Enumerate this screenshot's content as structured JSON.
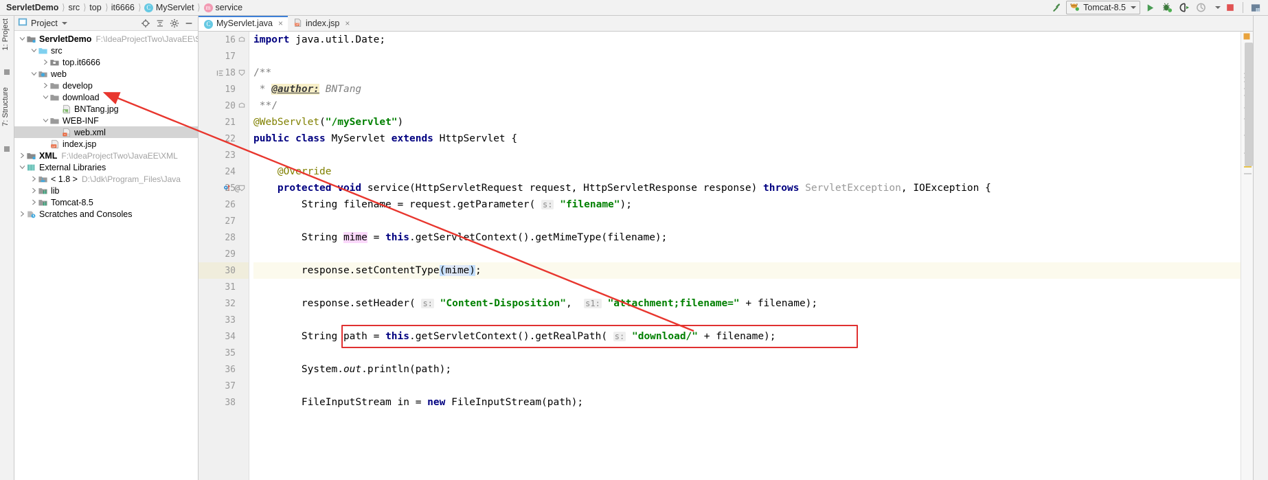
{
  "breadcrumb": {
    "items": [
      {
        "label": "ServletDemo",
        "icon": "",
        "bold": true
      },
      {
        "label": "src",
        "icon": "",
        "bold": false
      },
      {
        "label": "top",
        "icon": "",
        "bold": false
      },
      {
        "label": "it6666",
        "icon": "",
        "bold": false
      },
      {
        "label": "MyServlet",
        "icon": "class-icon",
        "bold": false
      },
      {
        "label": "service",
        "icon": "method-icon",
        "bold": false
      }
    ]
  },
  "toolbar": {
    "build_icon": "hammer-icon",
    "run_config": {
      "label": "Tomcat-8.5",
      "icon": "tomcat-icon",
      "dropdown": "chevron-down-icon"
    },
    "run_icon": "run-triangle-icon",
    "debug_icon": "debug-bug-icon",
    "run_coverage_icon": "run-with-coverage-icon",
    "profile_icon": "profiler-icon",
    "profile_dropdown": "chevron-down-icon",
    "stop_icon": "stop-square-icon",
    "layout_icon": "window-layout-icon",
    "accent_run": "#499c54",
    "accent_stop": "#e05252",
    "accent_tab": "#3d7fd6"
  },
  "left_strip": {
    "project_label": "1: Project",
    "structure_label": "7: Structure"
  },
  "project_panel": {
    "title": "Project",
    "title_icon": "project-view-icon",
    "actions": [
      {
        "name": "locate-icon"
      },
      {
        "name": "collapse-all-icon"
      },
      {
        "name": "settings-gear-icon"
      },
      {
        "name": "hide-minus-icon"
      }
    ],
    "tree": [
      {
        "indent": 0,
        "arrow": "down",
        "icon": "module-icon",
        "label": "ServletDemo",
        "bold": true,
        "path": "F:\\IdeaProjectTwo\\JavaEE\\ServletD",
        "selected": false
      },
      {
        "indent": 1,
        "arrow": "down",
        "icon": "source-folder-icon",
        "label": "src",
        "bold": false,
        "path": "",
        "selected": false
      },
      {
        "indent": 2,
        "arrow": "right",
        "icon": "package-icon",
        "label": "top.it6666",
        "bold": false,
        "path": "",
        "selected": false
      },
      {
        "indent": 1,
        "arrow": "down",
        "icon": "web-folder-icon",
        "label": "web",
        "bold": false,
        "path": "",
        "selected": false
      },
      {
        "indent": 2,
        "arrow": "right",
        "icon": "folder-icon",
        "label": "develop",
        "bold": false,
        "path": "",
        "selected": false
      },
      {
        "indent": 2,
        "arrow": "down",
        "icon": "folder-icon",
        "label": "download",
        "bold": false,
        "path": "",
        "selected": false
      },
      {
        "indent": 3,
        "arrow": "none",
        "icon": "image-file-icon",
        "label": "BNTang.jpg",
        "bold": false,
        "path": "",
        "selected": false
      },
      {
        "indent": 2,
        "arrow": "down",
        "icon": "folder-icon",
        "label": "WEB-INF",
        "bold": false,
        "path": "",
        "selected": false
      },
      {
        "indent": 3,
        "arrow": "none",
        "icon": "xml-file-icon",
        "label": "web.xml",
        "bold": false,
        "path": "",
        "selected": true
      },
      {
        "indent": 2,
        "arrow": "none",
        "icon": "jsp-file-icon",
        "label": "index.jsp",
        "bold": false,
        "path": "",
        "selected": false
      },
      {
        "indent": 0,
        "arrow": "right",
        "icon": "module-icon",
        "label": "XML",
        "bold": true,
        "path": "F:\\IdeaProjectTwo\\JavaEE\\XML",
        "selected": false
      },
      {
        "indent": 0,
        "arrow": "down",
        "icon": "libraries-icon",
        "label": "External Libraries",
        "bold": false,
        "path": "",
        "selected": false
      },
      {
        "indent": 1,
        "arrow": "right",
        "icon": "jdk-icon",
        "label": "< 1.8 >",
        "bold": false,
        "path": "D:\\Jdk\\Program_Files\\Java",
        "selected": false
      },
      {
        "indent": 1,
        "arrow": "right",
        "icon": "library-icon",
        "label": "lib",
        "bold": false,
        "path": "",
        "selected": false
      },
      {
        "indent": 1,
        "arrow": "right",
        "icon": "library-icon",
        "label": "Tomcat-8.5",
        "bold": false,
        "path": "",
        "selected": false
      },
      {
        "indent": 0,
        "arrow": "right",
        "icon": "scratches-icon",
        "label": "Scratches and Consoles",
        "bold": false,
        "path": "",
        "selected": false
      }
    ]
  },
  "editor": {
    "tabs": [
      {
        "label": "MyServlet.java",
        "icon": "java-class-icon",
        "active": true,
        "close": "×"
      },
      {
        "label": "index.jsp",
        "icon": "jsp-file-icon",
        "active": false,
        "close": "×"
      }
    ],
    "first_line_number": 16,
    "lines": [
      {
        "num": "16",
        "fold": "end",
        "highlight": false,
        "marks": []
      },
      {
        "num": "17",
        "fold": "",
        "highlight": false,
        "marks": []
      },
      {
        "num": "18",
        "fold": "start",
        "highlight": false,
        "marks": [
          "indent-guide-icon"
        ]
      },
      {
        "num": "19",
        "fold": "",
        "highlight": false,
        "marks": []
      },
      {
        "num": "20",
        "fold": "end",
        "highlight": false,
        "marks": []
      },
      {
        "num": "21",
        "fold": "",
        "highlight": false,
        "marks": []
      },
      {
        "num": "22",
        "fold": "",
        "highlight": false,
        "marks": []
      },
      {
        "num": "23",
        "fold": "",
        "highlight": false,
        "marks": []
      },
      {
        "num": "24",
        "fold": "",
        "highlight": false,
        "marks": []
      },
      {
        "num": "25",
        "fold": "start",
        "highlight": false,
        "marks": [
          "override-method-icon",
          "at-icon"
        ]
      },
      {
        "num": "26",
        "fold": "",
        "highlight": false,
        "marks": []
      },
      {
        "num": "27",
        "fold": "",
        "highlight": false,
        "marks": []
      },
      {
        "num": "28",
        "fold": "",
        "highlight": false,
        "marks": []
      },
      {
        "num": "29",
        "fold": "",
        "highlight": false,
        "marks": []
      },
      {
        "num": "30",
        "fold": "",
        "highlight": true,
        "marks": []
      },
      {
        "num": "31",
        "fold": "",
        "highlight": false,
        "marks": []
      },
      {
        "num": "32",
        "fold": "",
        "highlight": false,
        "marks": []
      },
      {
        "num": "33",
        "fold": "",
        "highlight": false,
        "marks": []
      },
      {
        "num": "34",
        "fold": "",
        "highlight": false,
        "marks": []
      },
      {
        "num": "35",
        "fold": "",
        "highlight": false,
        "marks": []
      },
      {
        "num": "36",
        "fold": "",
        "highlight": false,
        "marks": []
      },
      {
        "num": "37",
        "fold": "",
        "highlight": false,
        "marks": []
      },
      {
        "num": "38",
        "fold": "",
        "highlight": false,
        "marks": []
      }
    ],
    "code": [
      "import java.util.Date;",
      "",
      "/**",
      " * @author: BNTang",
      " **/",
      "@WebServlet(\"/myServlet\")",
      "public class MyServlet extends HttpServlet {",
      "",
      "    @Override",
      "    protected void service(HttpServletRequest request, HttpServletResponse response) throws ServletException, IOException {",
      "        String filename = request.getParameter( s: \"filename\");",
      "",
      "        String mime = this.getServletContext().getMimeType(filename);",
      "",
      "        response.setContentType(mime);",
      "",
      "        response.setHeader( s: \"Content-Disposition\",  s1: \"attachment;filename=\" + filename);",
      "",
      "        String path = this.getServletContext().getRealPath( s: \"download/\" + filename);",
      "",
      "        System.out.println(path);",
      "",
      "        FileInputStream in = new FileInputStream(path);"
    ],
    "annotation": {
      "red_box_line": "34",
      "red_box_text": "String path = this.getServletContext().getRealPath( s: \"download/\" + filename);",
      "arrow_from_line": "34",
      "arrow_to_tree_item": "download",
      "color": "#e03030"
    },
    "params_hints": {
      "s": "s:",
      "s1": "s1:"
    }
  }
}
